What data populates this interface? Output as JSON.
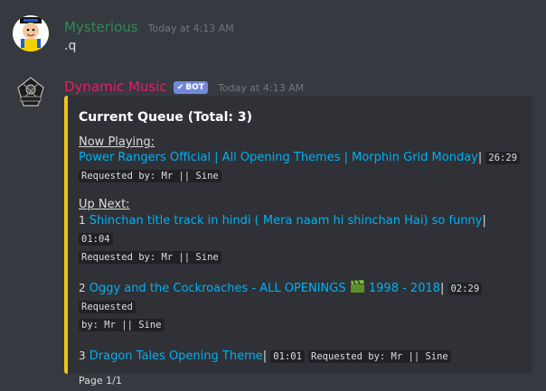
{
  "message1": {
    "username": "Mysterious",
    "username_color": "#2e8b57",
    "timestamp": "Today at 4:13 AM",
    "content": ".q"
  },
  "message2": {
    "username": "Dynamic Music",
    "username_color": "#e91e63",
    "bot_tag": "BOT",
    "timestamp": "Today at 4:13 AM",
    "avatar_text": "DYNAMIC",
    "embed": {
      "accent_color": "#f0c419",
      "title": "Current Queue (Total: 3)",
      "now_playing_label": "Now Playing:",
      "now_playing": {
        "title": "Power Rangers Official | All Opening Themes | Morphin Grid Monday",
        "duration": "26:29",
        "requested": "Requested by: Mr || Sine"
      },
      "up_next_label": "Up Next:",
      "queue": [
        {
          "num": "1",
          "title": "Shinchan title track in hindi ( Mera naam hi shinchan Hai) so funny",
          "duration": "01:04",
          "requested": "Requested by: Mr || Sine"
        },
        {
          "num": "2",
          "title_a": "Oggy and the Cockroaches - ALL OPENINGS",
          "title_b": "1998 - 2018",
          "duration": "02:29",
          "requested_a": "Requested",
          "requested_b": "by: Mr || Sine"
        },
        {
          "num": "3",
          "title": "Dragon Tales Opening Theme",
          "duration": "01:01",
          "requested": "Requested by: Mr || Sine"
        }
      ],
      "footer": "Page 1/1"
    }
  },
  "colors": {
    "background": "#36393f",
    "embed_bg": "#2f3136",
    "link": "#00b0f4",
    "timestamp": "#72767d"
  }
}
